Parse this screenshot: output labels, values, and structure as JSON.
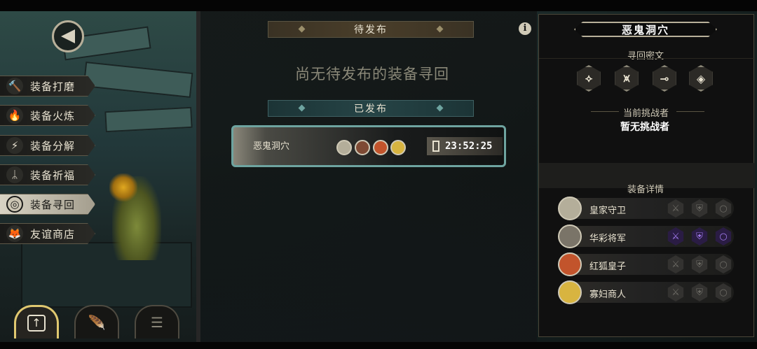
{
  "left_menu": {
    "items": [
      {
        "label": "装备打磨",
        "icon": "hammer-icon",
        "glyph": "🔨",
        "active": false
      },
      {
        "label": "装备火炼",
        "icon": "flame-icon",
        "glyph": "🔥",
        "active": false
      },
      {
        "label": "装备分解",
        "icon": "shatter-icon",
        "glyph": "⚡",
        "active": false
      },
      {
        "label": "装备祈福",
        "icon": "blessing-icon",
        "glyph": "ᛦ",
        "active": false
      },
      {
        "label": "装备寻回",
        "icon": "spiral-icon",
        "glyph": "◎",
        "active": true
      },
      {
        "label": "友谊商店",
        "icon": "fox-icon",
        "glyph": "🦊",
        "active": false
      }
    ]
  },
  "bottom_nav": [
    {
      "icon": "upload-icon",
      "glyph": "↑",
      "active": true
    },
    {
      "icon": "feather-icon",
      "glyph": "🪶",
      "active": false
    },
    {
      "icon": "list-icon",
      "glyph": "☰",
      "active": false
    }
  ],
  "center": {
    "pending_header": "待发布",
    "empty_message": "尚无待发布的装备寻回",
    "published_header": "已发布",
    "info_glyph": "i",
    "published_card": {
      "name": "恶鬼洞穴",
      "timer": "23:52:25",
      "avatars": [
        "royal-guard-avatar",
        "general-avatar",
        "fox-prince-avatar",
        "widow-merchant-avatar"
      ]
    }
  },
  "right": {
    "title": "恶鬼洞穴",
    "cipher_label": "寻回密文",
    "runes": [
      "⟡",
      "⩙",
      "⊸",
      "◈"
    ],
    "challenger_label": "当前挑战者",
    "challenger_value": "暂无挑战者",
    "details_label": "装备详情",
    "equipment": [
      {
        "name": "皇家守卫",
        "lit": false
      },
      {
        "name": "华彩将军",
        "lit": true
      },
      {
        "name": "红狐皇子",
        "lit": false
      },
      {
        "name": "寡妇商人",
        "lit": false
      }
    ]
  },
  "colors": {
    "accent_teal": "#6ea4a0",
    "gold": "#e0c870",
    "purple_lit": "#a47cf0"
  }
}
